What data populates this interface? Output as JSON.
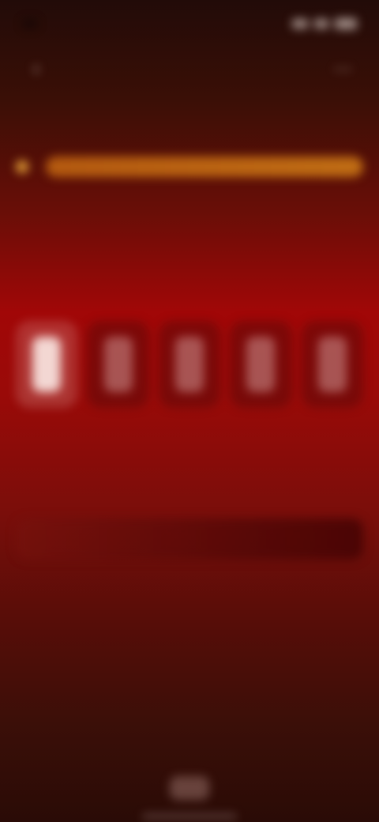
{
  "status": {
    "time": "",
    "network": "",
    "battery": ""
  },
  "header": {
    "title": "",
    "left_icon": "back-icon",
    "right_icon": "more-icon"
  },
  "section": {
    "label": ""
  },
  "quality": {
    "badge": "",
    "bar_text": "",
    "colors": {
      "badge": "#e2a036",
      "bar": "#c06d14"
    }
  },
  "word": {
    "title": "",
    "subtitle": ""
  },
  "candidates": [
    {
      "label": ""
    },
    {
      "label": ""
    },
    {
      "label": ""
    },
    {
      "label": ""
    },
    {
      "label": ""
    }
  ],
  "meaning": {
    "title": "",
    "subtitle": ""
  },
  "input": {
    "label": "",
    "placeholder": "",
    "value": ""
  },
  "bottom_button": {
    "label": ""
  },
  "theme": {
    "accent": "#a10707",
    "background_dark": "#2a0b06"
  }
}
